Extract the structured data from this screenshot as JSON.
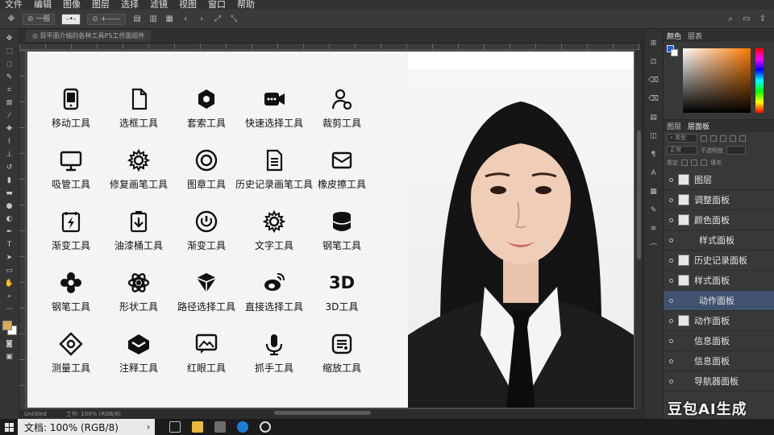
{
  "menu": [
    "文件",
    "编辑",
    "图像",
    "图层",
    "选择",
    "滤镜",
    "视图",
    "窗口",
    "帮助"
  ],
  "options_bar": {
    "chip1": "⊘ 一般",
    "chip2": "-•-",
    "chip3": "⊙ +——"
  },
  "document_tab": "◎ 目平面介絡的各种工具PS工作面组件",
  "status_bar": {
    "zoom_left": "Untitled",
    "info": "工作: 100% (RGB/8)"
  },
  "icon_grid": [
    {
      "icon": "tablet-icon",
      "label": "移动工具"
    },
    {
      "icon": "file-icon",
      "label": "选框工具"
    },
    {
      "icon": "lasso-hex-icon",
      "label": "套索工具"
    },
    {
      "icon": "video-icon",
      "label": "快速选择工具"
    },
    {
      "icon": "user-settings-icon",
      "label": "裁剪工具"
    },
    {
      "icon": "monitor-icon",
      "label": "吸管工具"
    },
    {
      "icon": "gear-icon",
      "label": "修复画笔工具"
    },
    {
      "icon": "target-icon",
      "label": "图章工具"
    },
    {
      "icon": "document-icon",
      "label": "历史记录画笔工具"
    },
    {
      "icon": "envelope-icon",
      "label": "橡皮擦工具"
    },
    {
      "icon": "lightning-icon",
      "label": "渐变工具"
    },
    {
      "icon": "download-icon",
      "label": "油漆桶工具"
    },
    {
      "icon": "power-icon",
      "label": "渐变工具"
    },
    {
      "icon": "gear-icon",
      "label": "文字工具"
    },
    {
      "icon": "database-icon",
      "label": "钢笔工具"
    },
    {
      "icon": "flower-icon",
      "label": "钢笔工具"
    },
    {
      "icon": "atom-icon",
      "label": "形状工具"
    },
    {
      "icon": "cube-icon",
      "label": "路径选择工具"
    },
    {
      "icon": "weibo-icon",
      "label": "直接选择工具"
    },
    {
      "icon": "3d-icon",
      "label": "3D工具",
      "glyph": "3D"
    },
    {
      "icon": "cog-diamond-icon",
      "label": "测量工具"
    },
    {
      "icon": "layers-icon",
      "label": "注释工具"
    },
    {
      "icon": "image-chat-icon",
      "label": "红眼工具"
    },
    {
      "icon": "microphone-icon",
      "label": "抓手工具"
    },
    {
      "icon": "list-box-icon",
      "label": "缩放工具"
    }
  ],
  "right_panel": {
    "top_tabs": [
      "颜色",
      "层表"
    ],
    "layer_tabs": [
      "图层",
      "层面板"
    ],
    "blend_mode": "正常",
    "opacity_label": "不透明度",
    "fill_label": "填充",
    "colors": {
      "foreground": "#1e5fd8",
      "background": "#ffffff",
      "selected_row": "#40526e"
    }
  },
  "layers": [
    {
      "label": "图层",
      "thumb": true,
      "selected": false,
      "indent": false
    },
    {
      "label": "调整面板",
      "thumb": true,
      "selected": false,
      "indent": false
    },
    {
      "label": "颜色面板",
      "thumb": true,
      "selected": false,
      "indent": false
    },
    {
      "label": "样式面板",
      "thumb": false,
      "selected": false,
      "indent": true
    },
    {
      "label": "历史记录面板",
      "thumb": true,
      "selected": false,
      "indent": false
    },
    {
      "label": "样式面板",
      "thumb": true,
      "selected": false,
      "indent": false
    },
    {
      "label": "动作面板",
      "thumb": false,
      "selected": true,
      "indent": true
    },
    {
      "label": "动作面板",
      "thumb": true,
      "selected": false,
      "indent": false
    },
    {
      "label": "信息面板",
      "thumb": false,
      "selected": false,
      "indent": false
    },
    {
      "label": "信息面板",
      "thumb": false,
      "selected": false,
      "indent": false
    },
    {
      "label": "导航器面板",
      "thumb": false,
      "selected": false,
      "indent": false
    }
  ],
  "watermark": "豆包AI生成",
  "taskbar": {
    "search_text": "文档: 100% (RGB/8)",
    "chevron": "›"
  }
}
